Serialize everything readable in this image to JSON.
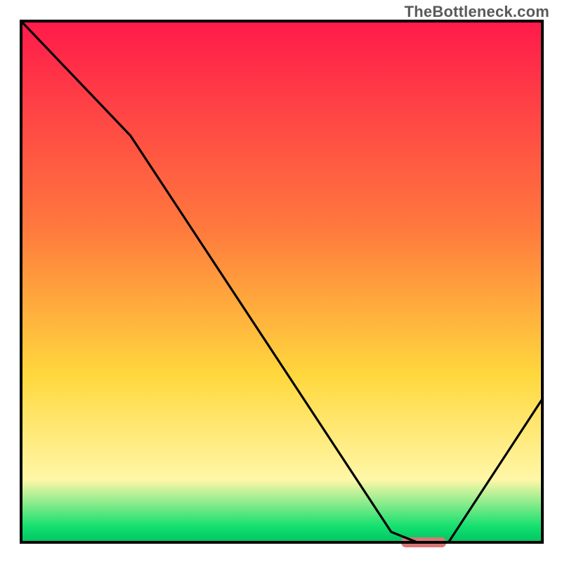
{
  "watermark": "TheBottleneck.com",
  "colors": {
    "frame": "#000000",
    "curve": "#000000",
    "marker_fill": "#d97777",
    "marker_stroke": "#d97777",
    "grad_top": "#ff1a4b",
    "grad_mid1": "#ff7a3d",
    "grad_mid2": "#ffd83d",
    "grad_mid3": "#fff7a8",
    "grad_green": "#13e06f",
    "grad_bottom": "#00c462"
  },
  "chart_data": {
    "type": "line",
    "title": "",
    "xlabel": "",
    "ylabel": "",
    "xlim": [
      0,
      100
    ],
    "ylim": [
      0,
      100
    ],
    "grid": false,
    "legend": false,
    "series": [
      {
        "name": "bottleneck-curve",
        "x": [
          0.0,
          21.0,
          71.0,
          76.0,
          82.0,
          100.0
        ],
        "values": [
          100.0,
          78.0,
          2.0,
          0.0,
          0.0,
          27.5
        ]
      }
    ],
    "marker": {
      "name": "optimal-zone",
      "x_start": 73.0,
      "x_end": 81.5,
      "y": 0.0,
      "thickness_pct": 1.8
    },
    "background_gradient": {
      "direction": "vertical",
      "stops": [
        {
          "pos": 0.0,
          "color": "#ff1a4b"
        },
        {
          "pos": 0.4,
          "color": "#ff7a3d"
        },
        {
          "pos": 0.68,
          "color": "#ffd83d"
        },
        {
          "pos": 0.88,
          "color": "#fff7a8"
        },
        {
          "pos": 0.97,
          "color": "#13e06f"
        },
        {
          "pos": 1.0,
          "color": "#00c462"
        }
      ]
    }
  }
}
